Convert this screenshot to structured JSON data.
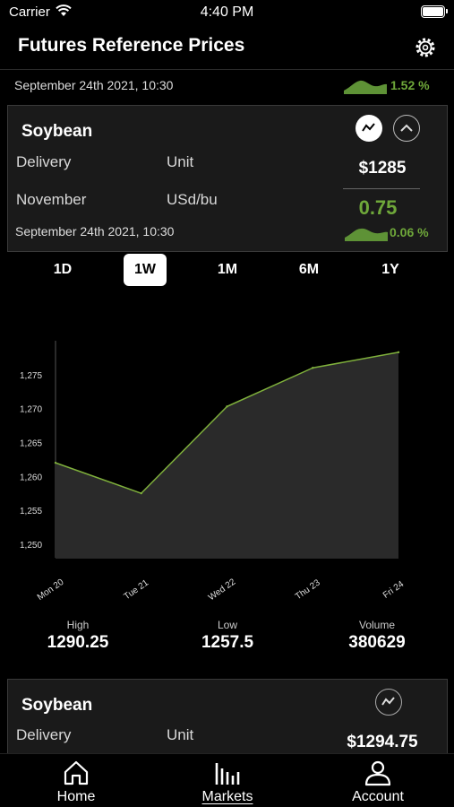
{
  "status_bar": {
    "carrier": "Carrier",
    "time": "4:40 PM"
  },
  "header": {
    "title": "Futures Reference Prices",
    "settings_icon": "gear-icon"
  },
  "summary": {
    "timestamp": "September 24th 2021, 10:30",
    "change_pct": "1.52 %"
  },
  "card": {
    "title": "Soybean",
    "delivery_label": "Delivery",
    "unit_label": "Unit",
    "delivery_value": "November",
    "unit_value": "USd/bu",
    "price": "$1285",
    "change": "0.75",
    "change_pct": "0.06 %",
    "timestamp": "September 24th 2021, 10:30"
  },
  "periods": [
    "1D",
    "1W",
    "1M",
    "6M",
    "1Y"
  ],
  "active_period": "1W",
  "chart_data": {
    "type": "area",
    "x": [
      "Mon 20",
      "Tue 21",
      "Wed 22",
      "Thu 23",
      "Fri 24"
    ],
    "values": [
      1262,
      1257.5,
      1270.3,
      1276,
      1278.3
    ],
    "yticks": [
      1250,
      1255,
      1260,
      1265,
      1270,
      1275
    ],
    "ytick_labels": [
      "1,250",
      "1,255",
      "1,260",
      "1,265",
      "1,270",
      "1,275"
    ],
    "ylim": [
      1248,
      1280
    ],
    "line_color": "#7fb03c",
    "fill_color": "#2a2a2a"
  },
  "stats": [
    {
      "label": "High",
      "value": "1290.25"
    },
    {
      "label": "Low",
      "value": "1257.5"
    },
    {
      "label": "Volume",
      "value": "380629"
    }
  ],
  "card2": {
    "title": "Soybean",
    "delivery_label": "Delivery",
    "unit_label": "Unit",
    "price": "$1294.75"
  },
  "tabs": [
    {
      "label": "Home",
      "icon": "home-icon"
    },
    {
      "label": "Markets",
      "icon": "bar-chart-icon"
    },
    {
      "label": "Account",
      "icon": "person-icon"
    }
  ],
  "colors": {
    "positive": "#6fa83a",
    "background": "#000000",
    "card": "#1a1a1a"
  }
}
